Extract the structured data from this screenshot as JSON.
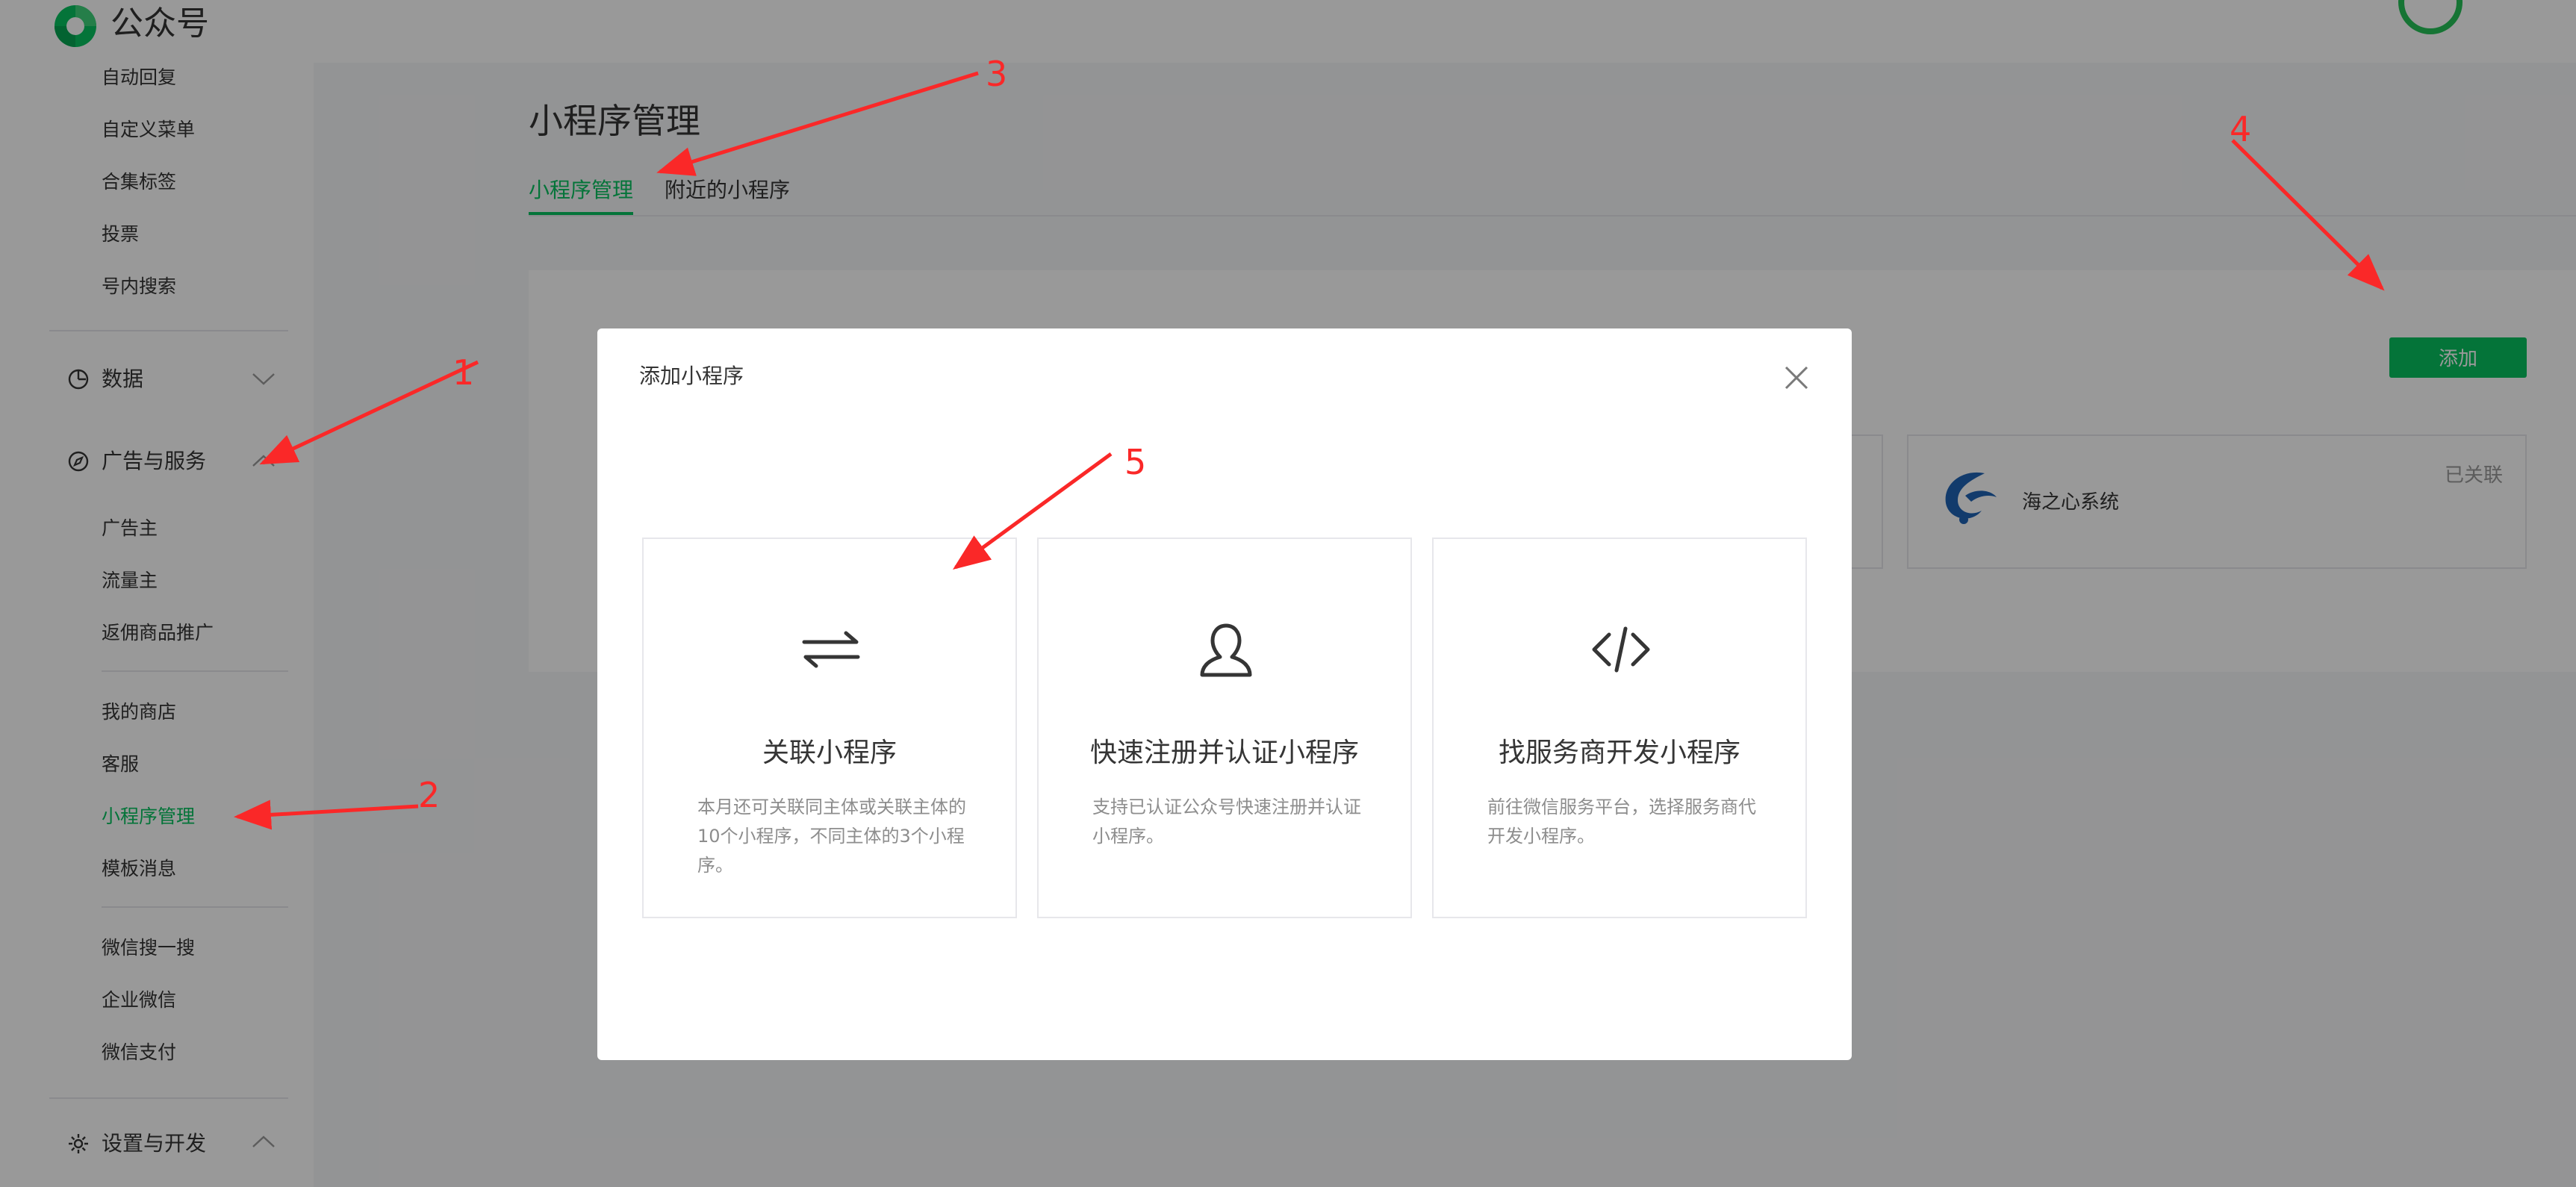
{
  "header": {
    "logo_text": "公众号"
  },
  "sidebar": {
    "items_top": [
      "自动回复",
      "自定义菜单",
      "合集标签",
      "投票",
      "号内搜索"
    ],
    "data_group": "数据",
    "ad_group": "广告与服务",
    "ad_items": [
      "广告主",
      "流量主",
      "返佣商品推广"
    ],
    "service_items": [
      "我的商店",
      "客服",
      "小程序管理",
      "模板消息"
    ],
    "other_items": [
      "微信搜一搜",
      "企业微信",
      "微信支付"
    ],
    "settings_group": "设置与开发"
  },
  "main": {
    "title": "小程序管理",
    "tabs": [
      "小程序管理",
      "附近的小程序"
    ],
    "add_button": "添加",
    "linked_card": {
      "name": "海之心系统",
      "status": "已关联"
    }
  },
  "dialog": {
    "title": "添加小程序",
    "options": [
      {
        "title": "关联小程序",
        "desc": "本月还可关联同主体或关联主体的10个小程序，不同主体的3个小程序。",
        "icon": "swap-arrows-icon"
      },
      {
        "title": "快速注册并认证小程序",
        "desc": "支持已认证公众号快速注册并认证小程序。",
        "icon": "user-icon"
      },
      {
        "title": "找服务商开发小程序",
        "desc": "前往微信服务平台，选择服务商代开发小程序。",
        "icon": "code-icon"
      }
    ]
  },
  "annotations": {
    "labels": [
      "1",
      "2",
      "3",
      "4",
      "5"
    ],
    "color": "#fa2828"
  },
  "colors": {
    "accent": "#07c160",
    "annotation": "#fa2828"
  }
}
